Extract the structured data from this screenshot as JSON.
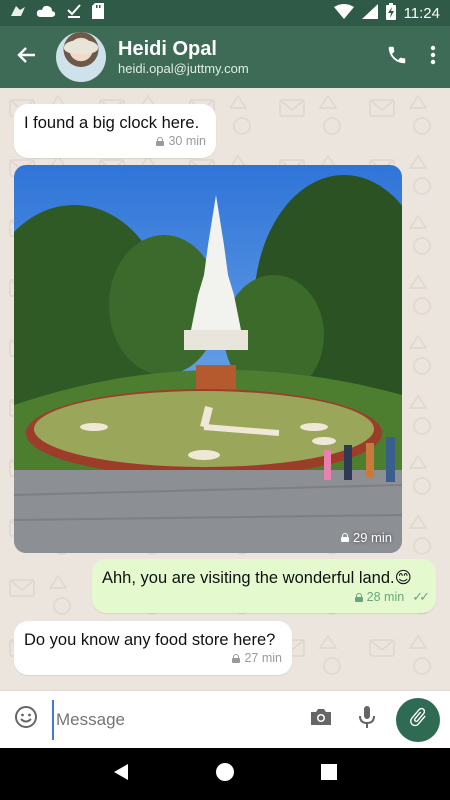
{
  "status_bar": {
    "time": "11:24",
    "icons": [
      "bird-icon",
      "cloud-icon",
      "download-done-icon",
      "sd-card-icon",
      "wifi-icon",
      "signal-icon",
      "battery-charging-icon"
    ]
  },
  "header": {
    "back_icon": "arrow-back-icon",
    "contact_name": "Heidi Opal",
    "contact_email": "heidi.opal@juttmy.com",
    "call_icon": "phone-icon",
    "menu_icon": "more-vert-icon"
  },
  "messages": [
    {
      "direction": "incoming",
      "text": "I found a big clock here.",
      "time": "30 min"
    },
    {
      "direction": "incoming",
      "type": "image",
      "time": "29 min"
    },
    {
      "direction": "outgoing",
      "text": "Ahh, you are visiting the wonderful land.😊",
      "time": "28 min",
      "status": "read"
    },
    {
      "direction": "incoming",
      "text": "Do you know any food store here?",
      "time": "27 min"
    }
  ],
  "composer": {
    "placeholder": "Message",
    "emoji_icon": "emoji-icon",
    "camera_icon": "camera-icon",
    "mic_icon": "mic-icon",
    "attach_icon": "paperclip-icon"
  },
  "colors": {
    "header": "#3d6b55",
    "status_bar": "#2f5a47",
    "outgoing_bubble": "#e5f9cf",
    "chat_bg": "#ece5dd",
    "attach_button": "#2f6b52"
  }
}
